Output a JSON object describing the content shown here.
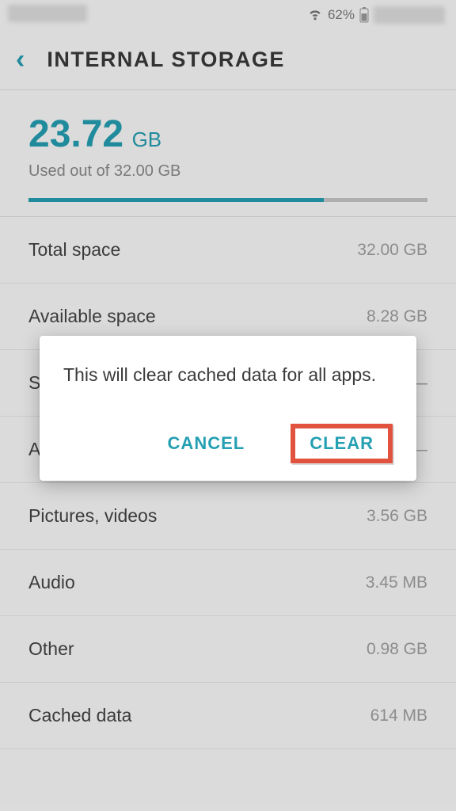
{
  "statusBar": {
    "batteryPercent": "62%"
  },
  "header": {
    "title": "INTERNAL STORAGE"
  },
  "usage": {
    "amount": "23.72",
    "unit": "GB",
    "subtext": "Used out of 32.00 GB",
    "fillPercent": "74%"
  },
  "items": [
    {
      "label": "Total space",
      "value": "32.00 GB"
    },
    {
      "label": "Available space",
      "value": "8.28 GB"
    },
    {
      "label": "System memory",
      "value": "—"
    },
    {
      "label": "Apps",
      "value": "—"
    },
    {
      "label": "Pictures, videos",
      "value": "3.56 GB"
    },
    {
      "label": "Audio",
      "value": "3.45 MB"
    },
    {
      "label": "Other",
      "value": "0.98 GB"
    },
    {
      "label": "Cached data",
      "value": "614 MB"
    }
  ],
  "dialog": {
    "message": "This will clear cached data for all apps.",
    "cancel": "CANCEL",
    "confirm": "CLEAR"
  }
}
